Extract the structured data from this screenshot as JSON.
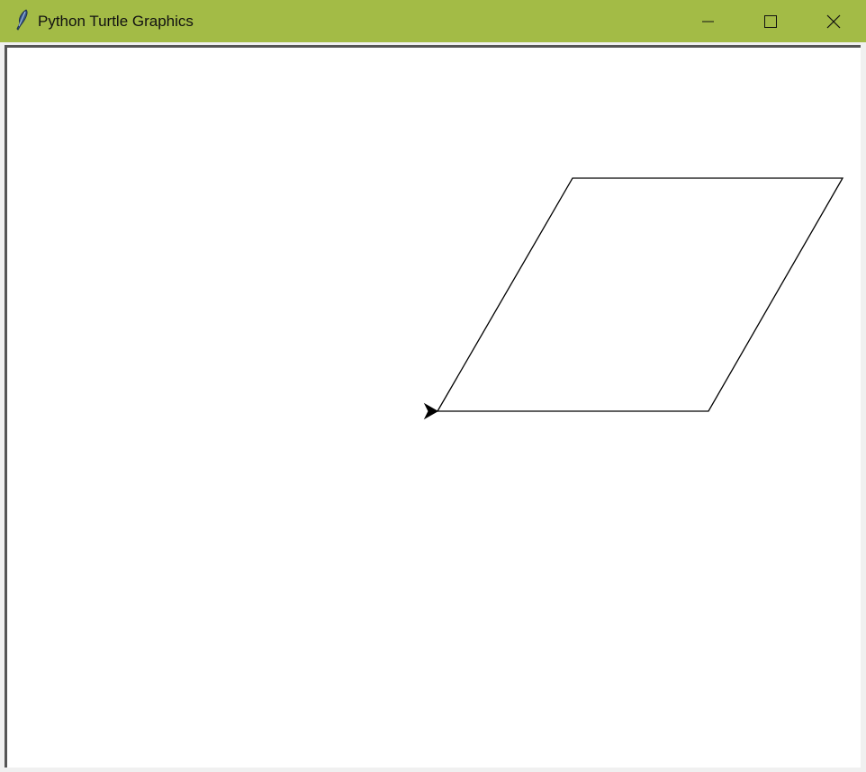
{
  "window": {
    "title": "Python Turtle Graphics",
    "icon": "feather-icon",
    "controls": {
      "minimize_icon": "minimize-icon",
      "maximize_icon": "maximize-icon",
      "close_icon": "close-icon"
    },
    "titlebar_color": "#a3bb46"
  },
  "canvas": {
    "background": "#ffffff",
    "stroke_color": "#000000",
    "turtle": {
      "shape": "classic",
      "heading_deg": 180,
      "color": "#000000"
    }
  }
}
